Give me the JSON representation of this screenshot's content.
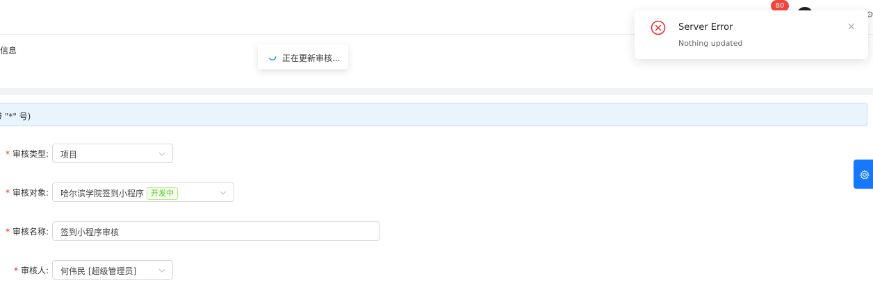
{
  "header": {
    "notification_count": "80",
    "corner_glyph": "⚙"
  },
  "page": {
    "title": "核信息"
  },
  "info_bar": {
    "text": "带 \"*\" 号)"
  },
  "loading_toast": {
    "text": "正在更新审核..."
  },
  "notification": {
    "title": "Server Error",
    "description": "Nothing updated",
    "type": "error",
    "icon": "close-circle-icon"
  },
  "form": {
    "required_mark": "*",
    "fields": [
      {
        "label": "审核类型:",
        "value": "项目",
        "kind": "select"
      },
      {
        "label": "审核对象:",
        "value": "哈尔滨学院签到小程序",
        "tag": "开发中",
        "kind": "select"
      },
      {
        "label": "审核名称:",
        "value": "签到小程序审核",
        "kind": "input"
      },
      {
        "label": "审核人:",
        "value": "何伟民 [超级管理员]",
        "kind": "select"
      }
    ]
  },
  "colors": {
    "primary": "#1677ff",
    "error": "#f5222d",
    "success_tag": "#52c41a",
    "badge": "#f2453d"
  }
}
